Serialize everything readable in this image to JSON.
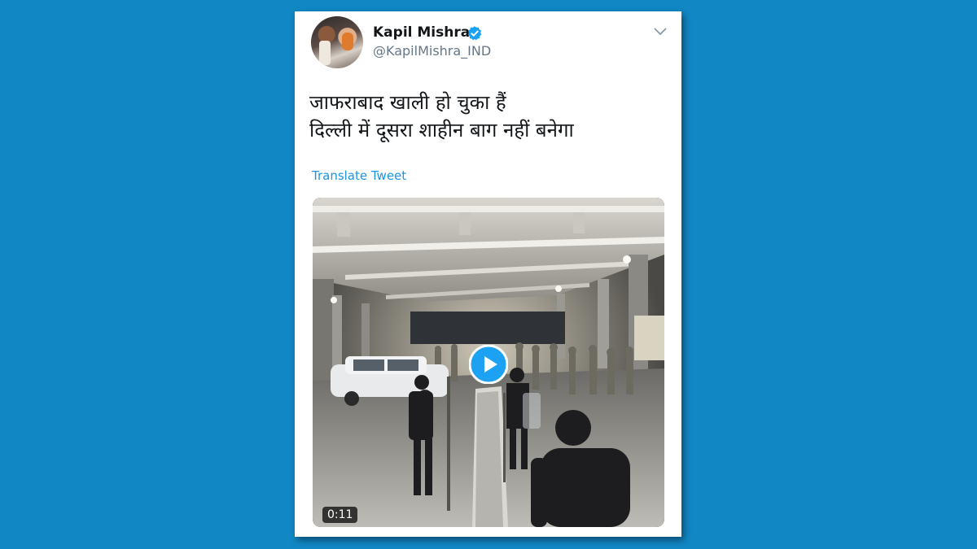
{
  "tweet": {
    "author_name": "Kapil Mishra",
    "author_handle": "@KapilMishra_IND",
    "text_line1": "जाफराबाद खाली हो चुका हैं",
    "text_line2": "दिल्ली में दूसरा शाहीन बाग नहीं बनेगा",
    "translate_label": "Translate Tweet",
    "verified_icon": "verified-badge-icon",
    "menu_icon": "chevron-down-icon"
  },
  "media": {
    "type": "video",
    "duration": "0:11",
    "play_icon": "play-icon"
  },
  "colors": {
    "background": "#1187c4",
    "link": "#1b95e0",
    "verified": "#1da1f2",
    "secondary_text": "#657786"
  }
}
